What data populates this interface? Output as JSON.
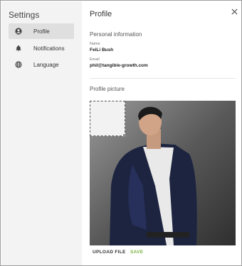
{
  "sidebar": {
    "title": "Settings",
    "items": [
      {
        "label": "Profile",
        "icon": "account-circle-icon",
        "active": true
      },
      {
        "label": "Notifications",
        "icon": "bell-icon",
        "active": false
      },
      {
        "label": "Language",
        "icon": "globe-icon",
        "active": false
      }
    ]
  },
  "main": {
    "title": "Profile",
    "personal_info": {
      "heading": "Personal information",
      "name_label": "Name",
      "name_value": "FeiLi Bush",
      "email_label": "Email",
      "email_value": "phil@tangible-growth.com"
    },
    "profile_picture": {
      "heading": "Profile picture"
    },
    "actions": {
      "upload_label": "UPLOAD FILE",
      "save_label": "SAVE"
    }
  },
  "colors": {
    "accent_green": "#7cb342",
    "sidebar_bg": "#f3f3f3",
    "active_item_bg": "#dfdfdf"
  }
}
